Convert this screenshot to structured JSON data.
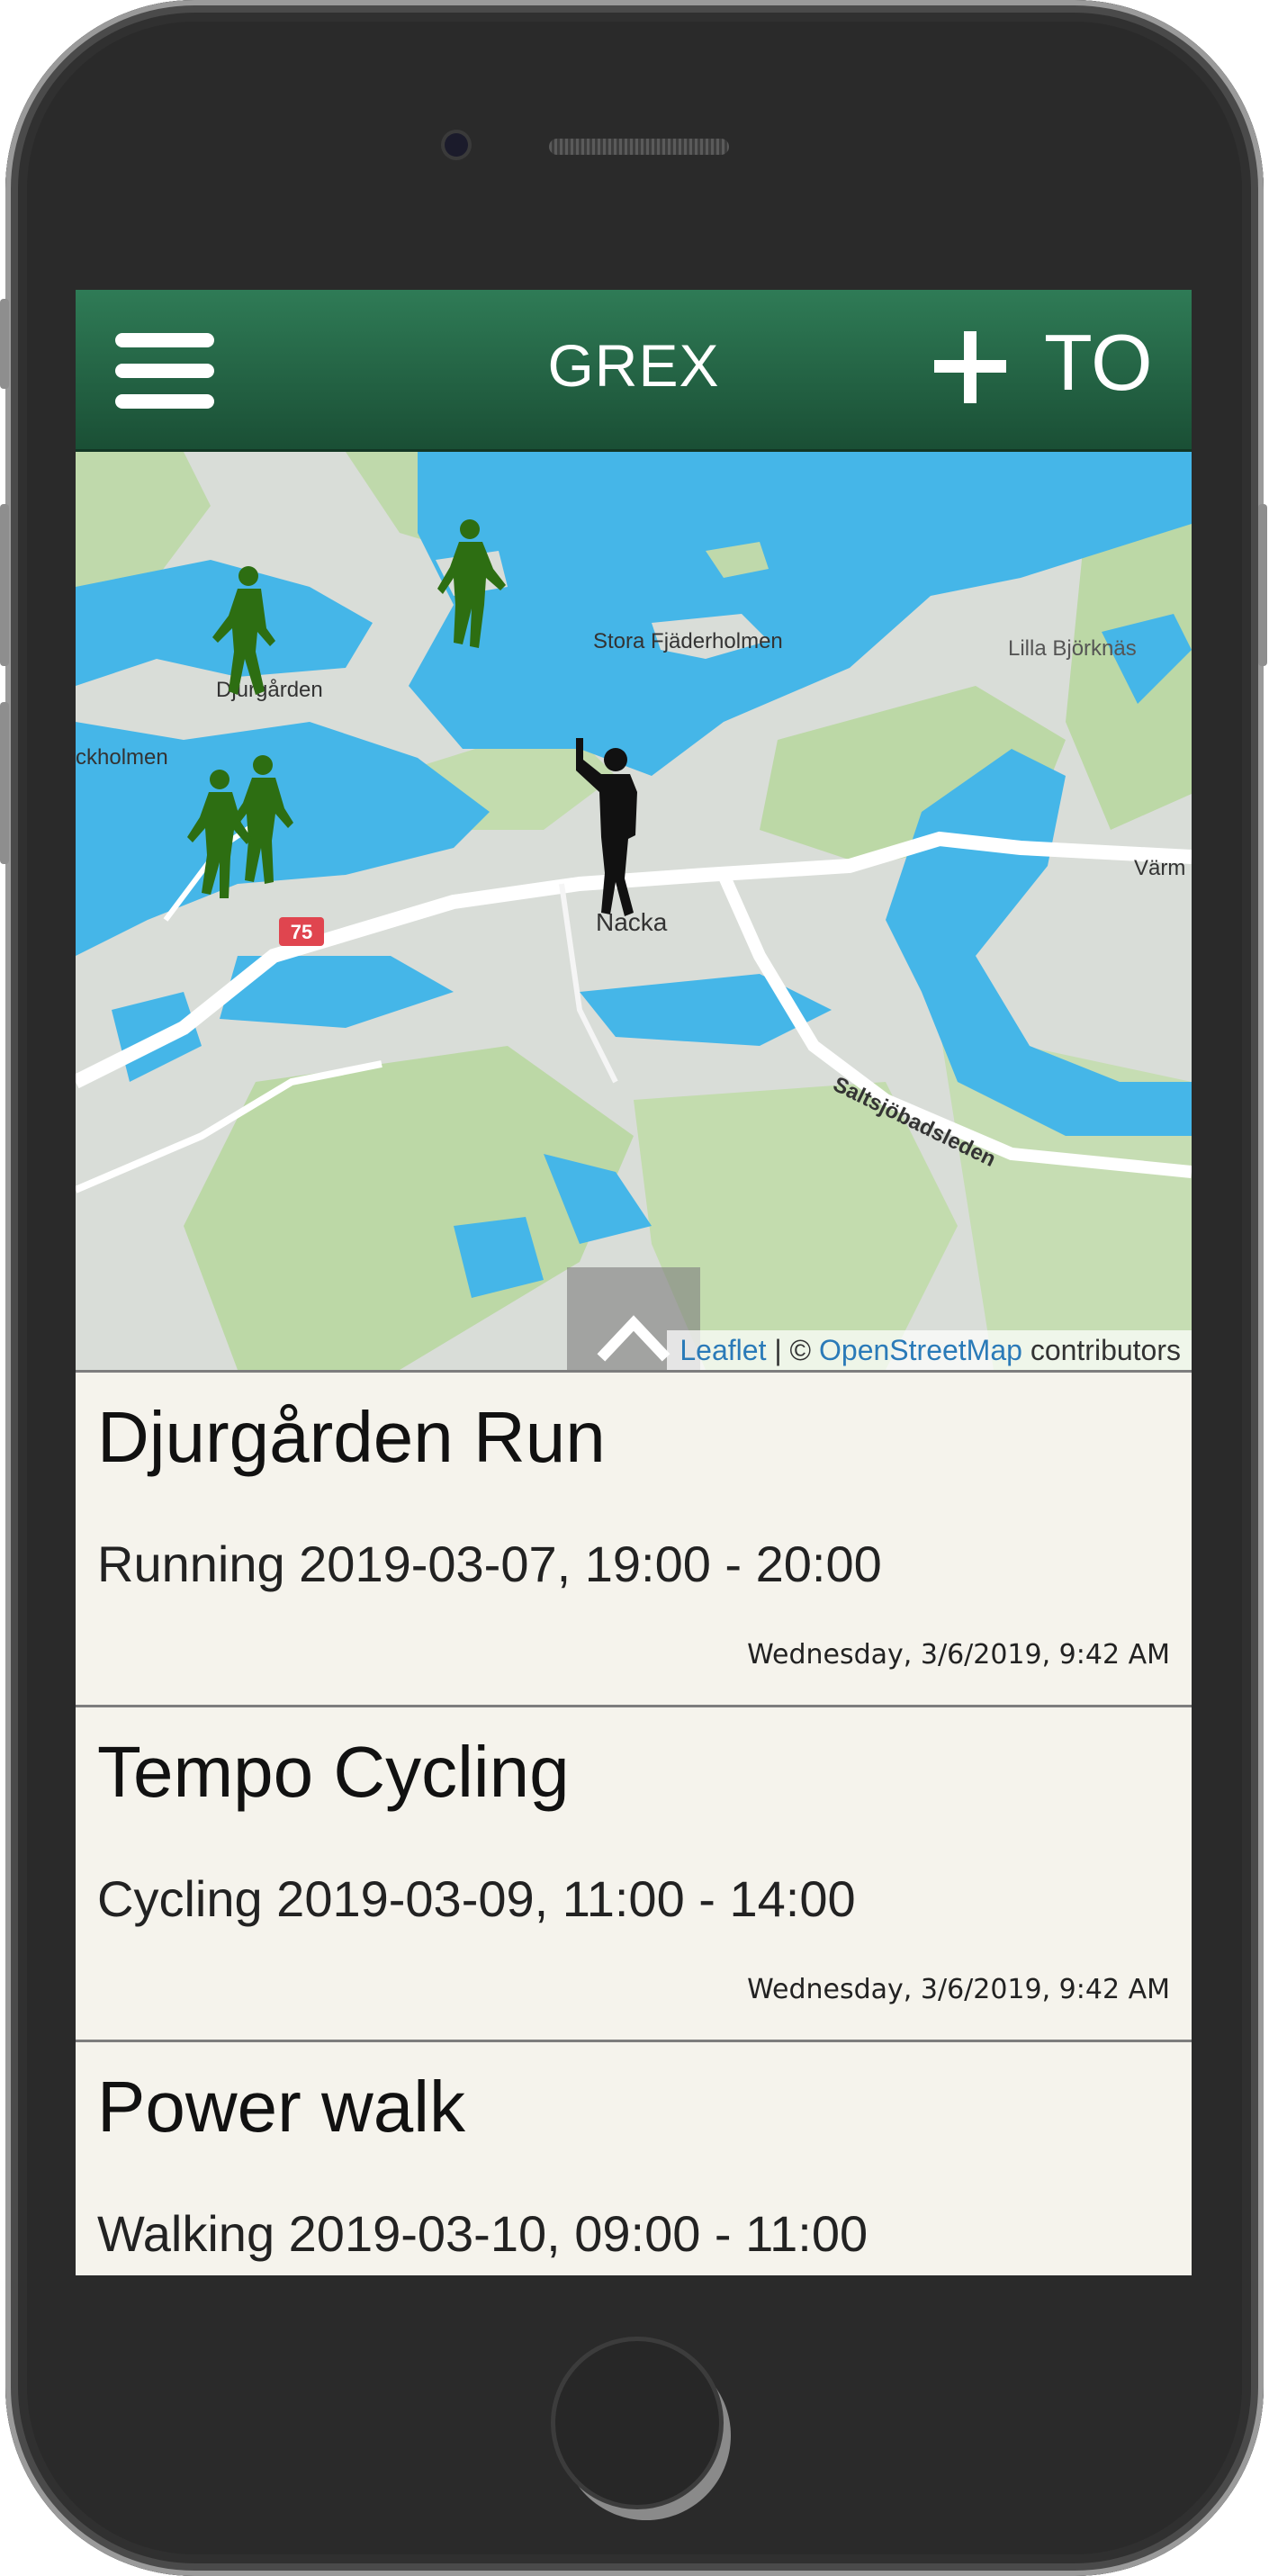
{
  "header": {
    "title": "GREX",
    "menu_icon": "hamburger-menu-icon",
    "add_icon": "plus-icon",
    "to_label": "TO",
    "background": "#236546"
  },
  "map": {
    "labels": {
      "stora_fjaderholmen": "Stora Fjäderholmen",
      "lilla_bjorknas": "Lilla Björknäs",
      "djurgarden": "Djurgården",
      "stockholmen": "ckholmen",
      "nacka": "Nacka",
      "varmdo": "Värm",
      "saltsjobadsleden": "Saltsjöbadsleden",
      "road_badge": "75"
    },
    "attribution": {
      "leaflet": "Leaflet",
      "separator": " | © ",
      "osm": "OpenStreetMap",
      "suffix": " contributors"
    },
    "collapse_icon": "chevron-up-icon",
    "markers": {
      "activity_icon": "runner-icon",
      "user_icon": "person-waving-icon",
      "activity_color": "#2d6e12",
      "user_color": "#111111"
    },
    "colors": {
      "water": "#45b6e8",
      "land": "#d8ddd7",
      "park": "#b9d5a5",
      "road": "#ffffff"
    }
  },
  "events": [
    {
      "title": "Djurgården Run",
      "subtitle": "Running 2019-03-07, 19:00 - 20:00",
      "created": "Wednesday, 3/6/2019, 9:42 AM"
    },
    {
      "title": "Tempo Cycling",
      "subtitle": "Cycling 2019-03-09, 11:00 - 14:00",
      "created": "Wednesday, 3/6/2019, 9:42 AM"
    },
    {
      "title": "Power walk",
      "subtitle": "Walking 2019-03-10, 09:00 - 11:00",
      "created": ""
    }
  ]
}
